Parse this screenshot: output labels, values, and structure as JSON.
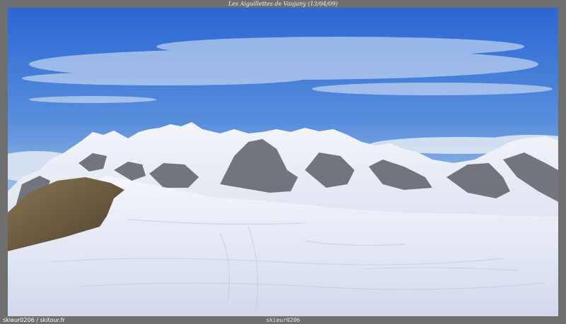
{
  "caption": "Les Aiguillettes de Vaujany (13/04/09)",
  "footer": {
    "credit": "skieur0206 / skitour.fr",
    "watermark": "skieur0206"
  },
  "colors": {
    "sky_top": "#2f6fd8",
    "sky_bottom": "#b9d0ea",
    "snow": "#eef1f8",
    "snow_shadow": "#c9d2ea",
    "rock": "#6a5a3c",
    "frame": "#6f6f6f"
  }
}
